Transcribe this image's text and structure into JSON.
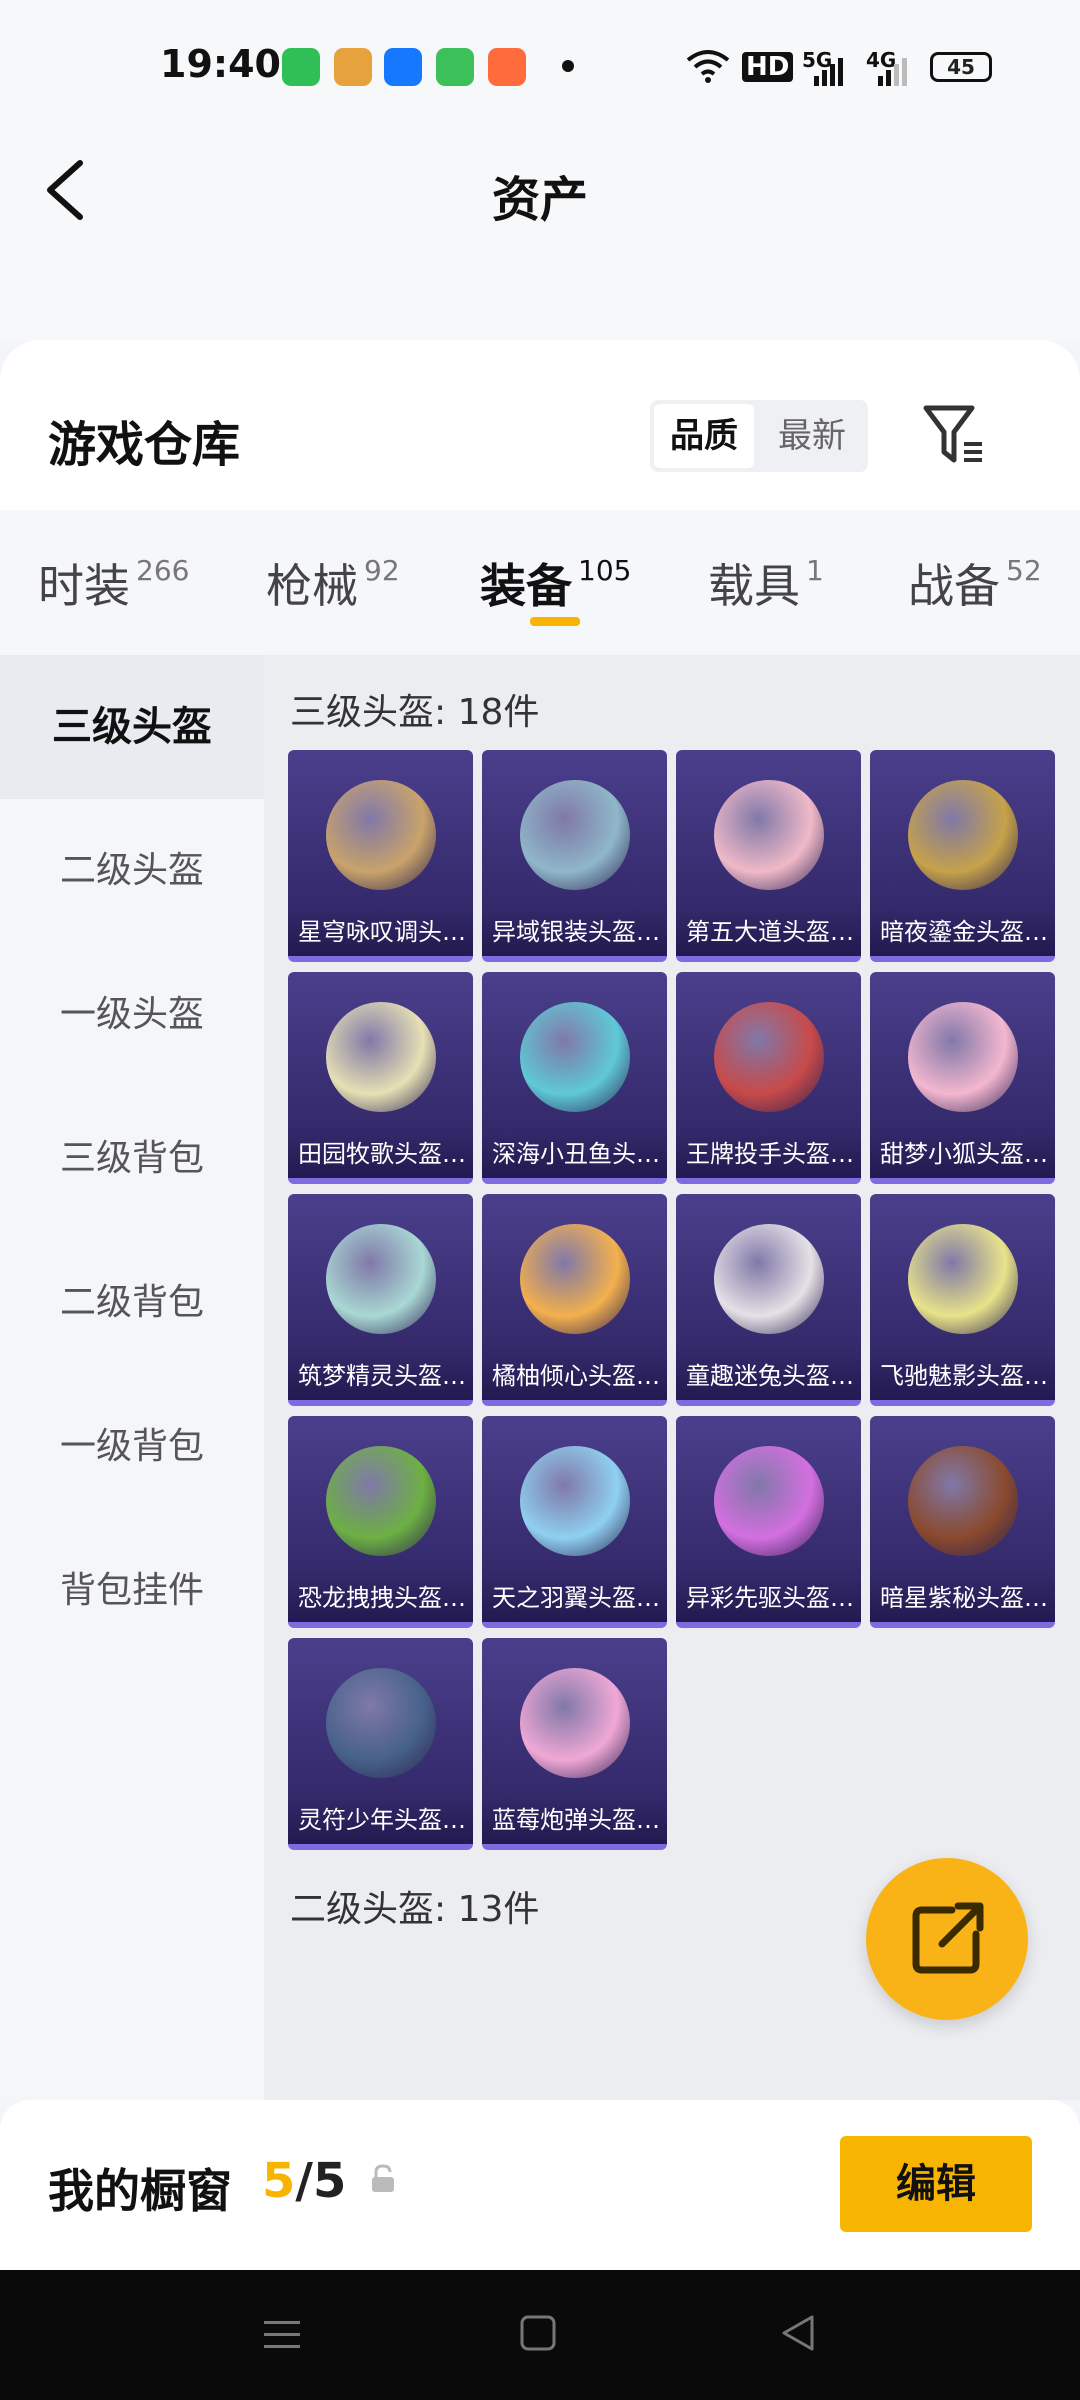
{
  "status_bar": {
    "time": "19:40",
    "network_hd": "HD",
    "net1": "5G",
    "net2": "4G",
    "battery": "45"
  },
  "header": {
    "title": "资产"
  },
  "warehouse": {
    "title": "游戏仓库",
    "sort_options": [
      "品质",
      "最新"
    ],
    "active_sort": "品质"
  },
  "category_tabs": [
    {
      "label": "时装",
      "count": "266"
    },
    {
      "label": "枪械",
      "count": "92"
    },
    {
      "label": "装备",
      "count": "105"
    },
    {
      "label": "载具",
      "count": "1"
    },
    {
      "label": "战备",
      "count": "52"
    }
  ],
  "sidebar": {
    "items": [
      "三级头盔",
      "二级头盔",
      "一级头盔",
      "三级背包",
      "二级背包",
      "一级背包",
      "背包挂件"
    ],
    "active": "三级头盔"
  },
  "sections": [
    {
      "title": "三级头盔: 18件",
      "items": [
        "星穹咏叹调头…",
        "异域银装头盔…",
        "第五大道头盔…",
        "暗夜鎏金头盔…",
        "田园牧歌头盔…",
        "深海小丑鱼头…",
        "王牌投手头盔…",
        "甜梦小狐头盔…",
        "筑梦精灵头盔…",
        "橘柚倾心头盔…",
        "童趣迷兔头盔…",
        "飞驰魅影头盔…",
        "恐龙拽拽头盔…",
        "天之羽翼头盔…",
        "异彩先驱头盔…",
        "暗星紫秘头盔…",
        "灵符少年头盔…",
        "蓝莓炮弹头盔…"
      ]
    },
    {
      "title": "二级头盔: 13件",
      "items": [
        "",
        "",
        "",
        ""
      ]
    }
  ],
  "bottom": {
    "label": "我的橱窗",
    "count_current": "5",
    "count_sep": "/",
    "count_total": "5",
    "edit_label": "编辑"
  },
  "colors": {
    "accent": "#f7b400",
    "card_top": "#4b3f8c",
    "card_bottom": "#2b2360",
    "card_border": "#7f6be0"
  },
  "icons": {
    "back": "chevron-left-icon",
    "filter": "filter-icon",
    "fab": "share-external-icon",
    "lock": "lock-icon"
  }
}
